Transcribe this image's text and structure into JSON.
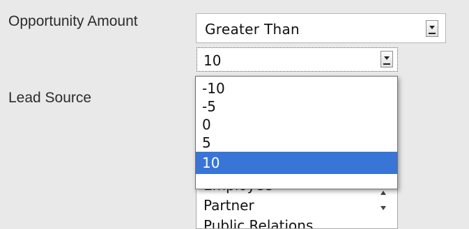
{
  "fields": {
    "opportunity_amount_label": "Opportunity Amount",
    "lead_source_label": "Lead Source"
  },
  "operator_select": {
    "value": "Greater Than"
  },
  "value_select": {
    "value": "10",
    "options": [
      "-10",
      "-5",
      "0",
      "5",
      "10"
    ],
    "selected_index": 4
  },
  "lead_source_list": {
    "items": [
      "Employee",
      "Partner",
      "Public Relations"
    ]
  },
  "colors": {
    "background": "#e9e9e9",
    "selection_highlight": "#3875d7"
  },
  "icons": {
    "dropdown": "chevron-down-icon",
    "scroll_up": "scroll-up-icon",
    "scroll_down": "scroll-down-icon"
  }
}
